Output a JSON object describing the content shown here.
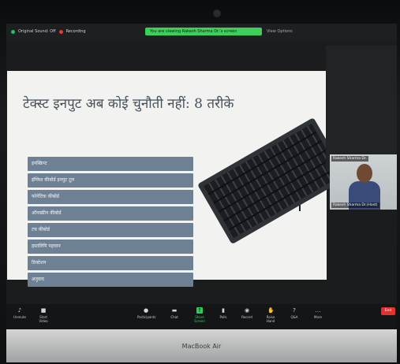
{
  "topbar": {
    "original_sound": "Original Sound: Off",
    "recording": "Recording",
    "sharing_banner": "You are viewing Rakesh Sharma Dr.'s screen",
    "view_options": "View Options"
  },
  "slide": {
    "title": "टेक्स्ट इनपुट अब कोई चुनौती नहीं: 8 तरीके",
    "items": [
      "इनस्क्रिप्ट",
      "इंग्लिश कीबोर्ड इनपुट टूल",
      "फोनेटिक कीबोर्ड",
      "ऑनस्क्रीन कीबोर्ड",
      "टच कीबोर्ड",
      "हस्तलिपि पहचान",
      "डिक्टेशन",
      "अनुवाद"
    ]
  },
  "participant": {
    "name_tag": "Rakesh Sharma Dr.",
    "label": "Rakesh Sharma Dr.(Host)"
  },
  "toolbar": {
    "unmute": "Unmute",
    "start_video": "Start Video",
    "participants": "Participants",
    "chat": "Chat",
    "share_screen": "Share Screen",
    "polls": "Polls",
    "record": "Record",
    "raise_hand": "Raise Hand",
    "qa": "Q&A",
    "more": "More",
    "end": "End"
  },
  "device": {
    "brand": "MacBook Air"
  },
  "colors": {
    "share_green": "#3ccf59",
    "item_bg": "#6e8094",
    "end_red": "#e5312d"
  }
}
